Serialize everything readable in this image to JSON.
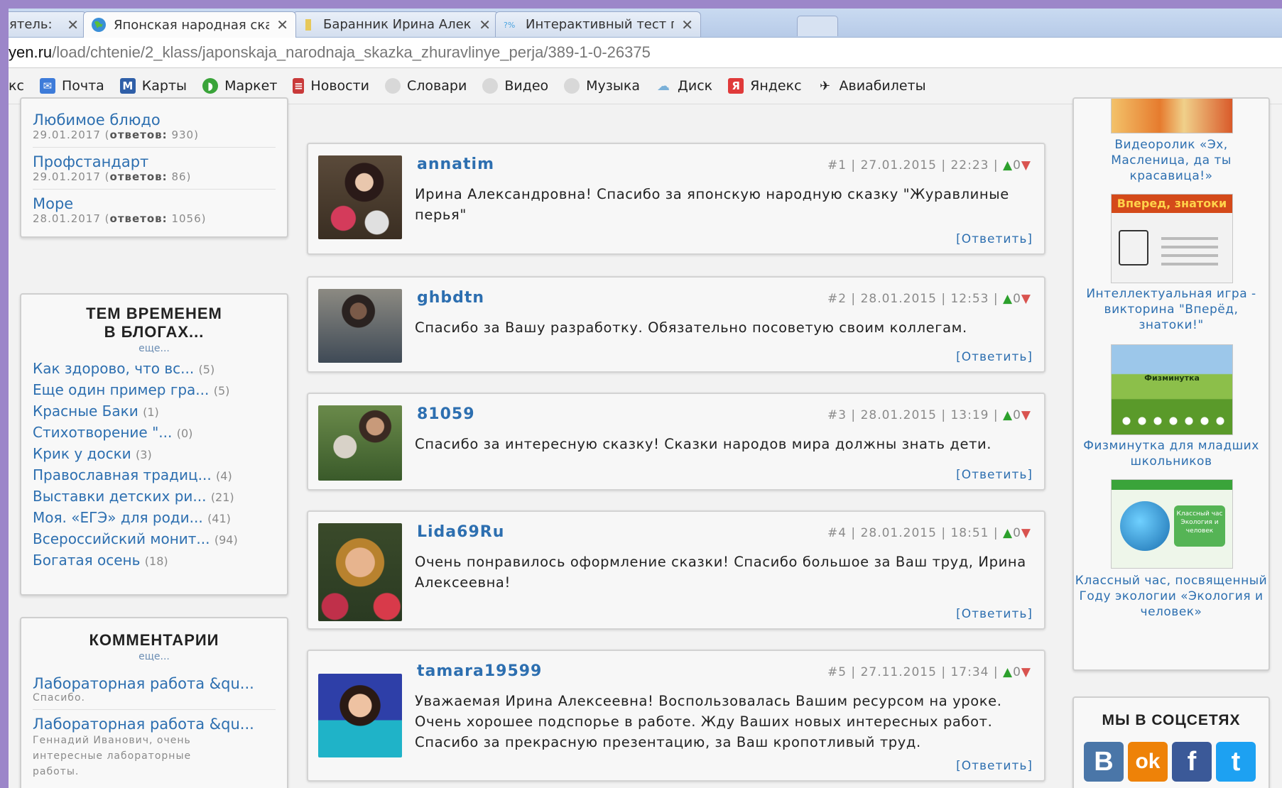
{
  "browser": {
    "tabs": [
      {
        "label": "ятель:",
        "active": false
      },
      {
        "label": "Японская народная ска:",
        "active": true
      },
      {
        "label": "Баранник Ирина Алекс:",
        "active": false
      },
      {
        "label": "Интерактивный тест по",
        "active": false
      }
    ],
    "close_glyph": "✕",
    "address": {
      "host": "yen.ru",
      "path": "/load/chtenie/2_klass/japonskaja_narodnaja_skazka_zhuravlinye_perja/389-1-0-26375"
    },
    "bookmarks": [
      {
        "label": "кс",
        "icon": ""
      },
      {
        "label": "Почта",
        "icon": "mail-icon"
      },
      {
        "label": "Карты",
        "icon": "maps-icon"
      },
      {
        "label": "Маркет",
        "icon": "market-icon"
      },
      {
        "label": "Новости",
        "icon": "news-icon"
      },
      {
        "label": "Словари",
        "icon": "dictionary-icon"
      },
      {
        "label": "Видео",
        "icon": "video-icon"
      },
      {
        "label": "Музыка",
        "icon": "music-icon"
      },
      {
        "label": "Диск",
        "icon": "disk-icon"
      },
      {
        "label": "Яндекс",
        "icon": "yandex-icon"
      },
      {
        "label": "Авиабилеты",
        "icon": "plane-icon"
      }
    ]
  },
  "left": {
    "top_items": [
      {
        "title": "Любимое блюдо",
        "date": "29.01.2017",
        "answers_label": "ответов:",
        "answers": "930"
      },
      {
        "title": "Профстандарт",
        "date": "29.01.2017",
        "answers_label": "ответов:",
        "answers": "86"
      },
      {
        "title": "Море",
        "date": "28.01.2017",
        "answers_label": "ответов:",
        "answers": "1056"
      }
    ],
    "blogs": {
      "heading_line1": "ТЕМ ВРЕМЕНЕМ",
      "heading_line2": "В БЛОГАХ...",
      "more": "еще...",
      "items": [
        {
          "title": "Как здорово, что вс...",
          "count": "(5)"
        },
        {
          "title": "Еще один пример гра...",
          "count": "(5)"
        },
        {
          "title": "Красные Баки",
          "count": "(1)"
        },
        {
          "title": "Стихотворение \"...",
          "count": "(0)"
        },
        {
          "title": "Крик у доски",
          "count": "(3)"
        },
        {
          "title": "Православная традиц...",
          "count": "(4)"
        },
        {
          "title": "Выставки детских ри...",
          "count": "(21)"
        },
        {
          "title": "Моя. «ЕГЭ» для роди...",
          "count": "(41)"
        },
        {
          "title": "Всероссийский монит...",
          "count": "(94)"
        },
        {
          "title": "Богатая осень",
          "count": "(18)"
        }
      ]
    },
    "comments": {
      "heading": "КОММЕНТАРИИ",
      "more": "еще...",
      "items": [
        {
          "title": "Лабораторная работа &qu...",
          "snippet": "Спасибо."
        },
        {
          "title": "Лабораторная работа &qu...",
          "snippet": "Геннадий Иванович, очень интересные лабораторные работы."
        }
      ]
    }
  },
  "comments": [
    {
      "author": "annatim",
      "num": "#1",
      "date": "27.01.2015",
      "time": "22:23",
      "rating": "0",
      "text": "Ирина Александровна! Спасибо за японскую народную сказку \"Журавлиные перья\"",
      "reply": "[Ответить]"
    },
    {
      "author": "ghbdtn",
      "num": "#2",
      "date": "28.01.2015",
      "time": "12:53",
      "rating": "0",
      "text": "Спасибо за Вашу разработку. Обязательно посоветую своим коллегам.",
      "reply": "[Ответить]"
    },
    {
      "author": "81059",
      "num": "#3",
      "date": "28.01.2015",
      "time": "13:19",
      "rating": "0",
      "text": "Спасибо за интересную сказку! Сказки народов мира должны знать дети.",
      "reply": "[Ответить]"
    },
    {
      "author": "Lida69Ru",
      "num": "#4",
      "date": "28.01.2015",
      "time": "18:51",
      "rating": "0",
      "text": "Очень понравилось оформление сказки! Спасибо большое за Ваш труд, Ирина Алексеевна!",
      "reply": "[Ответить]"
    },
    {
      "author": "tamara19599",
      "num": "#5",
      "date": "27.11.2015",
      "time": "17:34",
      "rating": "0",
      "text": "Уважаемая Ирина Алексеевна! Воспользовалась Вашим ресурсом на уроке. Очень хорошее подспорье в работе. Жду Ваших новых интересных работ. Спасибо за прекрасную презентацию, за Ваш кропотливый труд.",
      "reply": "[Ответить]"
    }
  ],
  "right": {
    "cards": [
      {
        "caption": "Видеоролик «Эх, Масленица, да ты красавица!»"
      },
      {
        "caption": "Интеллектуальная игра - викторина \"Вперёд, знатоки!\"",
        "thumb_text": "Вперед, знатоки"
      },
      {
        "caption": "Физминутка для младших школьников",
        "thumb_text": "Физминутка"
      },
      {
        "caption": "Классный час, посвященный Году экологии «Экология и человек»",
        "thumb_text": "Классный час Экология и человек"
      }
    ],
    "social": {
      "heading": "МЫ В СОЦСЕТЯХ",
      "items": [
        {
          "name": "vk",
          "glyph": "B",
          "color": "#4a76a8"
        },
        {
          "name": "odnoklassniki",
          "glyph": "ok",
          "color": "#ee8208"
        },
        {
          "name": "facebook",
          "glyph": "f",
          "color": "#3b5998"
        },
        {
          "name": "twitter",
          "glyph": "t",
          "color": "#1da1f2"
        }
      ]
    }
  }
}
